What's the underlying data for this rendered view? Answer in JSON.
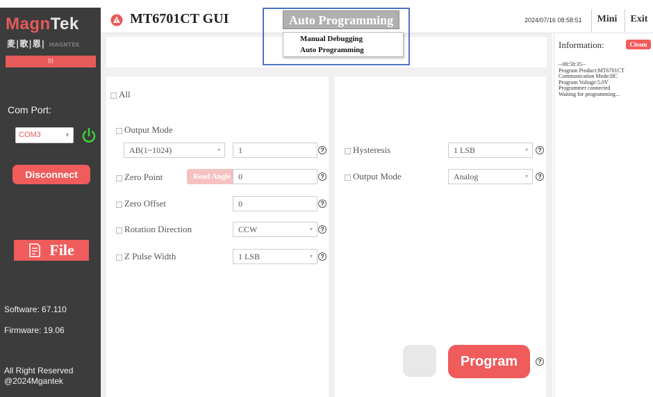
{
  "sidebar": {
    "logo_part1": "Magn",
    "logo_part2": "Tek",
    "logo_chinese": "麦|歌|恩|",
    "logo_chinese_sub": "MAGNTEK",
    "red_bar_label": "III",
    "com_port_label": "Com Port:",
    "com_port_value": "COM3",
    "disconnect_label": "Disconnect",
    "file_label": "File",
    "software_version": "Software:  67.110",
    "firmware_version": "Firmware:  19.06",
    "rights_line1": "All Right Reserved",
    "rights_line2": "@2024Mgantek"
  },
  "header": {
    "title": "MT6701CT GUI",
    "mode_selected": "Auto Programming",
    "datetime": "2024/07/16  08:58:51",
    "mini_label": "Mini",
    "exit_label": "Exit"
  },
  "dropdown": {
    "options": [
      "Manual Debugging",
      "Auto Programming"
    ]
  },
  "left_panel": {
    "all_label": "All",
    "output_mode_label": "Output Mode",
    "output_mode_select": "AB(1~1024)",
    "output_mode_value": "1",
    "zero_point_label": "Zero Point",
    "read_angle_label": "Read Angle",
    "zero_point_value": "0",
    "zero_offset_label": "Zero Offset",
    "zero_offset_value": "0",
    "rotation_label": "Rotation Direction",
    "rotation_value": "CCW",
    "z_pulse_label": "Z Pulse Width",
    "z_pulse_value": "1 LSB"
  },
  "right_panel": {
    "hysteresis_label": "Hysteresis",
    "hysteresis_value": "1 LSB",
    "output_mode_label": "Output Mode",
    "output_mode_value": "Analog",
    "program_label": "Program"
  },
  "info": {
    "title": "Information:",
    "clean_label": "Cleam",
    "log": [
      "--08:58:35--",
      "Program Product:MT6701CT",
      "Communication Mode:IIC",
      "Program Voltage:5.0V",
      "Programmer connected",
      "Waiting for programming..."
    ]
  },
  "colors": {
    "accent_red": "#f05b5b",
    "sidebar_bg": "#3c3c3c",
    "highlight_blue": "#4a72c4"
  },
  "icons": {
    "power": "power-icon",
    "warning": "warning-icon",
    "file": "file-icon",
    "help": "help-icon"
  }
}
